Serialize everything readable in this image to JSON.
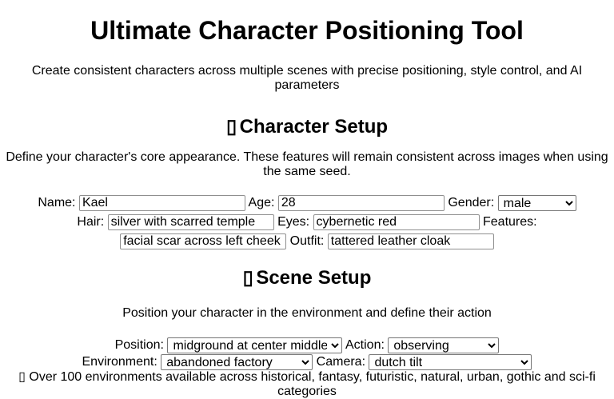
{
  "page": {
    "title": "Ultimate Character Positioning Tool",
    "subtitle": "Create consistent characters across multiple scenes with precise positioning, style control, and AI parameters"
  },
  "character_setup": {
    "heading": "Character Setup",
    "icon": "missing-glyph-icon",
    "description": "Define your character's core appearance. These features will remain consistent across images when using the same seed.",
    "name_label": "Name:",
    "name_value": "Kael",
    "age_label": "Age:",
    "age_value": "28",
    "gender_label": "Gender:",
    "gender_value": "male",
    "hair_label": "Hair:",
    "hair_value": "silver with scarred temple",
    "eyes_label": "Eyes:",
    "eyes_value": "cybernetic red",
    "features_label": "Features:",
    "features_value": "facial scar across left cheek",
    "outfit_label": "Outfit:",
    "outfit_value": "tattered leather cloak"
  },
  "scene_setup": {
    "heading": "Scene Setup",
    "icon": "missing-glyph-icon",
    "description": "Position your character in the environment and define their action",
    "position_label": "Position:",
    "position_value": "midground at center middle",
    "action_label": "Action:",
    "action_value": "observing",
    "environment_label": "Environment:",
    "environment_value": "abandoned factory",
    "camera_label": "Camera:",
    "camera_value": "dutch tilt",
    "note_icon": "missing-glyph-icon",
    "note": "Over 100 environments available across historical, fantasy, futuristic, natural, urban, gothic and sci-fi categories"
  }
}
